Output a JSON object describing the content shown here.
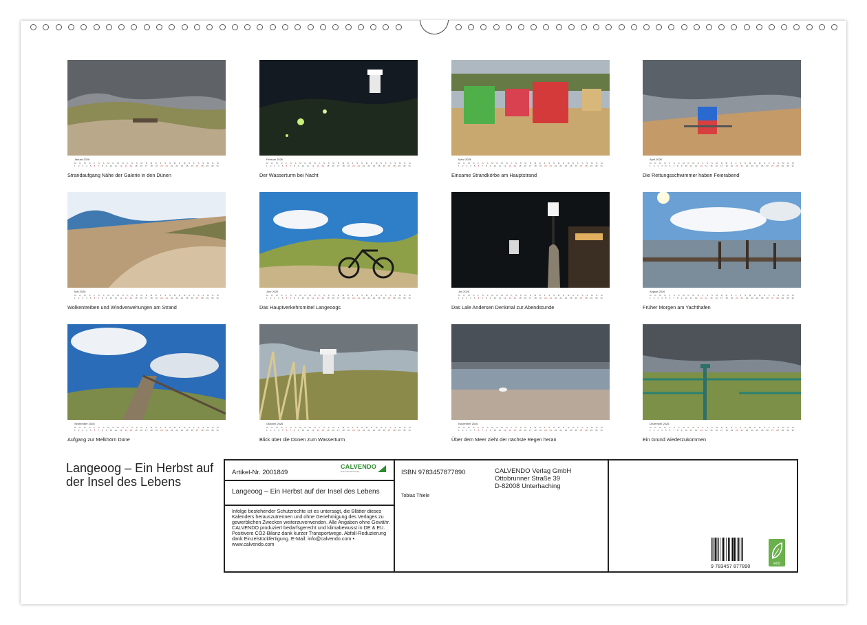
{
  "months": [
    {
      "month": "Januar 2026",
      "caption": "Strandaufgang Nähe der Galerie in den Dünen",
      "scene": "dunes-path"
    },
    {
      "month": "Februar 2026",
      "caption": "Der Wasserturm bei Nacht",
      "scene": "night-tower"
    },
    {
      "month": "März 2026",
      "caption": "Einsame Strandkörbe am Hauptstrand",
      "scene": "beach-chairs"
    },
    {
      "month": "April 2026",
      "caption": "Die Rettungsschwimmer haben Feierabend",
      "scene": "lifeguard"
    },
    {
      "month": "Mai 2026",
      "caption": "Wolkentreiben und Windverwehungen am Strand",
      "scene": "sand-dunes"
    },
    {
      "month": "Juni 2026",
      "caption": "Das Hauptverkehrsmittel Langeoogs",
      "scene": "bicycle"
    },
    {
      "month": "Juli 2026",
      "caption": "Das Lale Andersen Denkmal zur Abendstunde",
      "scene": "monument"
    },
    {
      "month": "August 2026",
      "caption": "Früher Morgen am Yachthafen",
      "scene": "harbor"
    },
    {
      "month": "September 2026",
      "caption": "Aufgang zur Melkhörn Düne",
      "scene": "stairs"
    },
    {
      "month": "Oktober 2026",
      "caption": "Blick über die Dünen zum Wasserturm",
      "scene": "tower-grass"
    },
    {
      "month": "November 2026",
      "caption": "Über dem Meer zieht der nächste Regen heran",
      "scene": "sea-storm"
    },
    {
      "month": "Dezember 2026",
      "caption": "Ein Grund wiederzukommen",
      "scene": "viewpoint"
    }
  ],
  "calendar": {
    "weekday_letters": [
      "M",
      "D",
      "M",
      "D",
      "F",
      "S",
      "S"
    ],
    "days": [
      "1",
      "2",
      "3",
      "4",
      "5",
      "6",
      "7",
      "8",
      "9",
      "10",
      "11",
      "12",
      "13",
      "14",
      "15",
      "16",
      "17",
      "18",
      "19",
      "20",
      "21",
      "22",
      "23",
      "24",
      "25",
      "26",
      "27",
      "28",
      "29",
      "30",
      "31"
    ],
    "weekend_color": "#c0392b"
  },
  "cover_title": "Langeoog – Ein Herbst auf der Insel des Lebens",
  "info": {
    "article_no": "Artikel-Nr. 2001849",
    "brand": "CALVENDO",
    "brand_tagline": "Dein Kalenderverlag",
    "product_title": "Langeoog – Ein Herbst auf der Insel des Lebens",
    "legal_text": "Infolge bestehender Schutzrechte ist es untersagt, die Blätter dieses Kalenders herauszutrennen und ohne Genehmigung des Verlages zu gewerblichen Zwecken weiterzuverwenden. Alle Angaben ohne Gewähr. CALVENDO produziert bedarfsgerecht und klimabewusst in DE & EU. Positivere CO2-Bilanz dank kurzer Transportwege. Abfall-Reduzierung dank Einzelstückfertigung. E-Mail: info@calvendo.com • www.calvendo.com",
    "isbn": "ISBN 9783457877890",
    "author": "Tobias Thiele",
    "publisher": "CALVENDO Verlag GmbH",
    "street": "Ottobrunner Straße 39",
    "city": "D-82008 Unterhaching",
    "barcode_digits": "9 783457 877890",
    "eco_label": "eco"
  },
  "colors": {
    "brand_green": "#2e8b2e",
    "eco_green": "#6ab04c"
  }
}
